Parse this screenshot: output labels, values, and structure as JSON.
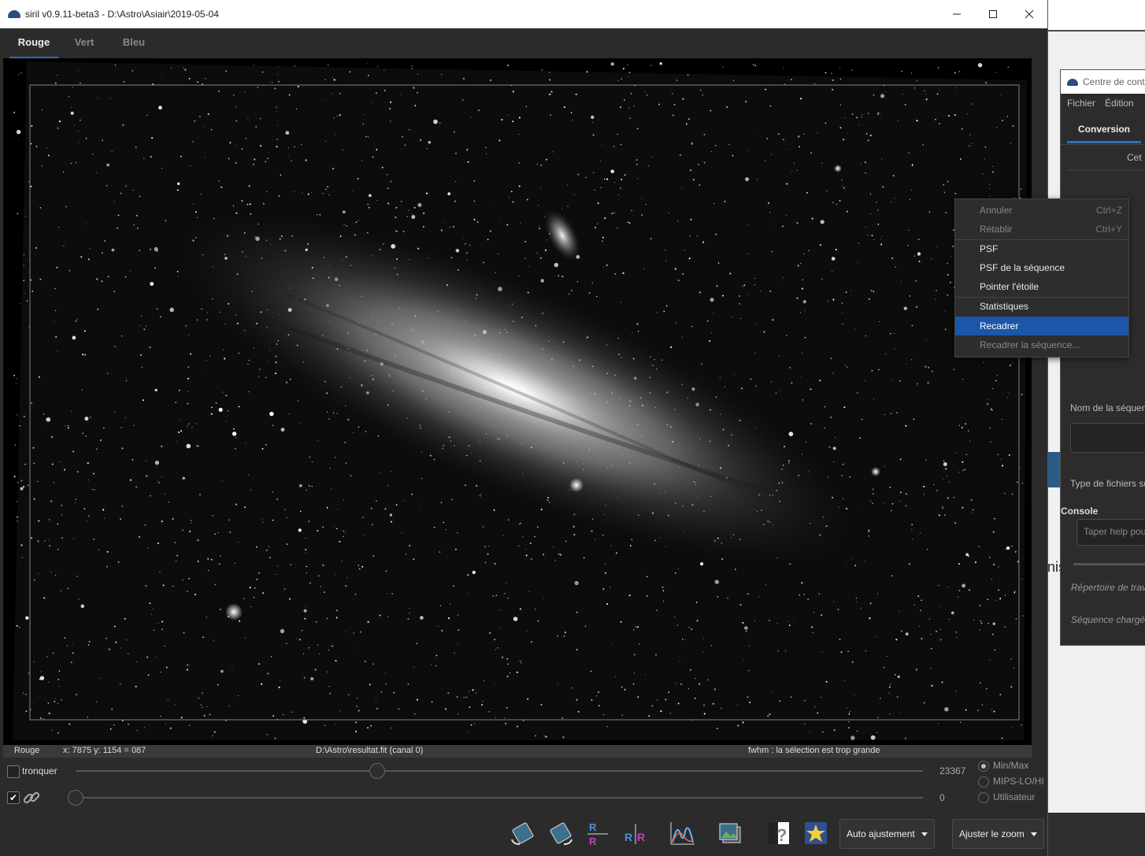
{
  "main_window": {
    "title": "siril v0.9.11-beta3 - D:\\Astro\\Asiair\\2019-05-04",
    "buttons": {
      "minimize": "✕",
      "maximize": "☐",
      "close": "✕"
    }
  },
  "tabs": [
    "Rouge",
    "Vert",
    "Bleu"
  ],
  "active_tab": "Rouge",
  "status": {
    "channel": "Rouge",
    "coords": "x: 7875 y: 1154 = 087",
    "file": "D:\\Astro\\resultat.fit (canal 0)",
    "message": "fwhm : la sélection est trop grande"
  },
  "controls": {
    "tronquer_label": "tronquer",
    "slider_hi_value": "23367",
    "slider_lo_value": "0",
    "modes": [
      "Min/Max",
      "MIPS-LO/HI",
      "Utilisateur"
    ],
    "selected_mode": "Min/Max",
    "auto_button": "Auto ajustement",
    "zoom_button": "Ajuster le zoom"
  },
  "context_menu": {
    "items": [
      {
        "label": "Annuler",
        "shortcut": "Ctrl+Z",
        "disabled": true
      },
      {
        "label": "Rétablir",
        "shortcut": "Ctrl+Y",
        "disabled": true
      },
      {
        "label": "PSF",
        "shortcut": "",
        "disabled": false
      },
      {
        "label": "PSF de la séquence",
        "shortcut": "",
        "disabled": false
      },
      {
        "label": "Pointer l'étoile",
        "shortcut": "",
        "disabled": false
      },
      {
        "label": "Statistiques",
        "shortcut": "",
        "disabled": false
      },
      {
        "label": "Recadrer",
        "shortcut": "",
        "disabled": false,
        "highlighted": true
      },
      {
        "label": "Recadrer la séquence...",
        "shortcut": "",
        "disabled": true
      }
    ]
  },
  "second_window": {
    "title": "Centre de cont",
    "menu": [
      "Fichier",
      "Édition"
    ],
    "tab": "Conversion",
    "text_cet": "Cet",
    "seq_name_label": "Nom de la séquen",
    "file_type_label": "Type de fichiers su",
    "console_label": "Console",
    "console_placeholder": "Taper help pou",
    "work_dir_label": "Répertoire de trav",
    "loaded_seq_label": "Séquence chargée"
  },
  "desktop_fragment": "nis",
  "colors": {
    "accent": "#2a6fb5",
    "menu_highlight": "#1c56a8",
    "panel": "#2b2b2b"
  }
}
